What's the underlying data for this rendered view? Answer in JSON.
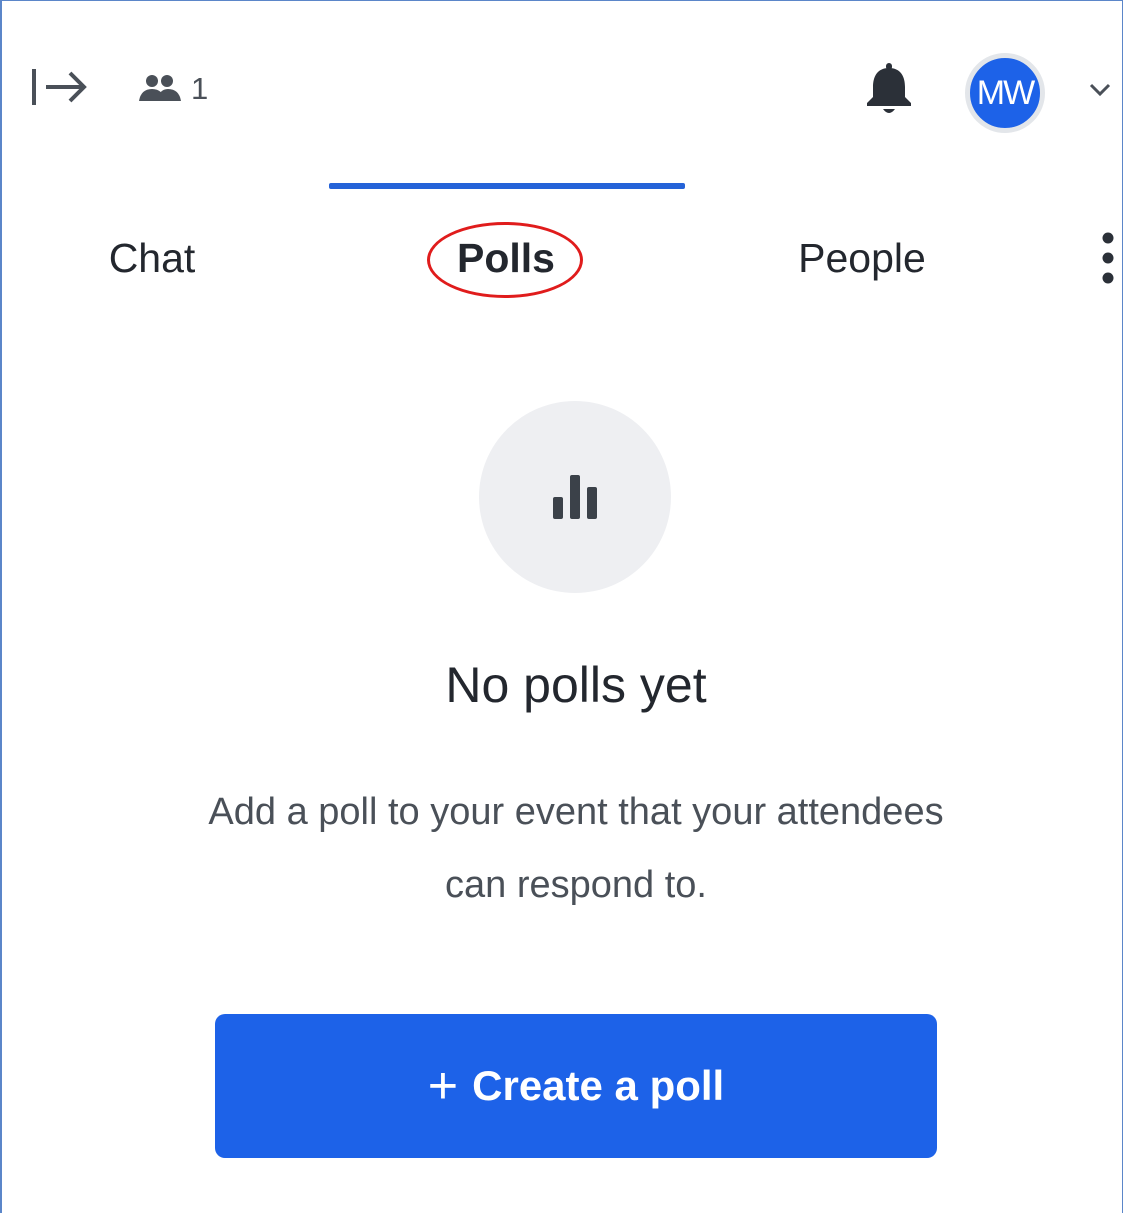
{
  "header": {
    "attendee_count": "1",
    "avatar_initials": "MW"
  },
  "tabs": [
    {
      "label": "Chat",
      "active": false
    },
    {
      "label": "Polls",
      "active": true
    },
    {
      "label": "People",
      "active": false
    }
  ],
  "empty_state": {
    "title": "No polls yet",
    "description": "Add a poll to your event that your attendees can respond to."
  },
  "create_button": {
    "icon": "+",
    "label": "Create a poll"
  },
  "icons": {
    "collapse": "collapse-right-icon",
    "attendees": "people-icon",
    "notifications": "bell-icon",
    "account_menu": "chevron-down-icon",
    "more": "more-vertical-icon",
    "empty_state": "bar-chart-icon"
  },
  "colors": {
    "primary": "#1d62e8",
    "tab_indicator": "#2563d8",
    "annotation": "#e01c1c",
    "text": "#23272e",
    "muted_text": "#4a5058",
    "icon_bg": "#eeeff2"
  }
}
